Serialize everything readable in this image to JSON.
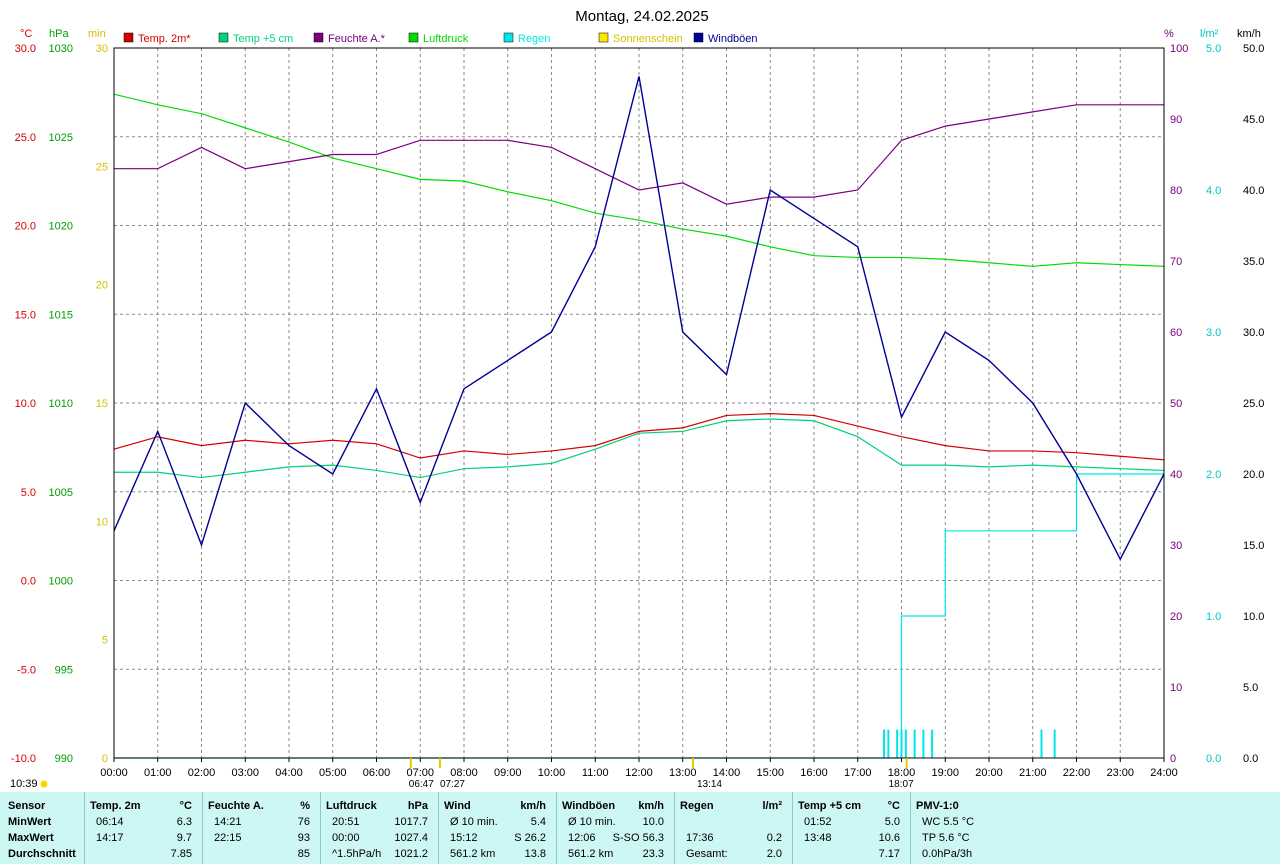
{
  "title": "Montag, 24.02.2025",
  "units": {
    "temp": "°C",
    "pressure": "hPa",
    "sunshine": "min",
    "humidity": "%",
    "rain": "l/m²",
    "wind": "km/h"
  },
  "legend": [
    {
      "label": "Temp. 2m*",
      "color": "#d40000"
    },
    {
      "label": "Temp +5 cm",
      "color": "#00d27a"
    },
    {
      "label": "Feuchte A.*",
      "color": "#7a0080"
    },
    {
      "label": "Luftdruck",
      "color": "#00dc00"
    },
    {
      "label": "Regen",
      "color": "#00e6e6"
    },
    {
      "label": "Sonnenschein",
      "color": "#ffe600"
    },
    {
      "label": "Windböen",
      "color": "#000096"
    }
  ],
  "axis_labels": {
    "temp": [
      "30.0",
      "25.0",
      "20.0",
      "15.0",
      "10.0",
      "5.0",
      "0.0",
      "-5.0",
      "-10.0"
    ],
    "pressure": [
      "1030",
      "1025",
      "1020",
      "1015",
      "1010",
      "1005",
      "1000",
      "995",
      "990"
    ],
    "sunshine": [
      "30",
      "25",
      "20",
      "15",
      "10",
      "5",
      "0"
    ],
    "humidity": [
      "100",
      "90",
      "80",
      "70",
      "60",
      "50",
      "40",
      "30",
      "20",
      "10",
      "0"
    ],
    "rain": [
      "5.0",
      "4.0",
      "3.0",
      "2.0",
      "1.0",
      "0.0"
    ],
    "wind": [
      "50.0",
      "45.0",
      "40.0",
      "35.0",
      "30.0",
      "25.0",
      "20.0",
      "15.0",
      "10.0",
      "5.0",
      "0.0"
    ],
    "time": [
      "00:00",
      "01:00",
      "02:00",
      "03:00",
      "04:00",
      "05:00",
      "06:00",
      "07:00",
      "08:00",
      "09:00",
      "10:00",
      "11:00",
      "12:00",
      "13:00",
      "14:00",
      "15:00",
      "16:00",
      "17:00",
      "18:00",
      "19:00",
      "20:00",
      "21:00",
      "22:00",
      "23:00",
      "24:00"
    ]
  },
  "markers": {
    "current_time": "10:39",
    "dawn": "06:47",
    "sunrise": "07:27",
    "solar_noon": "13:14",
    "sunset": "18:07"
  },
  "chart_data": {
    "type": "line",
    "xlabel": "",
    "xlim": [
      "00:00",
      "24:00"
    ],
    "axes": {
      "temp": [
        -10,
        30
      ],
      "pressure": [
        990,
        1030
      ],
      "sunshine": [
        0,
        30
      ],
      "humidity": [
        0,
        100
      ],
      "rain": [
        0,
        5
      ],
      "wind": [
        0,
        50
      ]
    },
    "x": [
      0,
      1,
      2,
      3,
      4,
      5,
      6,
      7,
      8,
      9,
      10,
      11,
      12,
      13,
      14,
      15,
      16,
      17,
      18,
      19,
      20,
      21,
      22,
      23,
      24
    ],
    "series": [
      {
        "name": "Temp. 2m*",
        "axis": "temp",
        "color": "#d40000",
        "values": [
          7.4,
          8.1,
          7.6,
          7.9,
          7.7,
          7.9,
          7.7,
          6.9,
          7.3,
          7.1,
          7.3,
          7.6,
          8.4,
          8.6,
          9.3,
          9.4,
          9.3,
          8.7,
          8.1,
          7.6,
          7.3,
          7.3,
          7.2,
          7.0,
          6.8
        ]
      },
      {
        "name": "Temp +5 cm",
        "axis": "temp",
        "color": "#00d27a",
        "values": [
          6.1,
          6.1,
          5.8,
          6.1,
          6.4,
          6.5,
          6.2,
          5.8,
          6.3,
          6.4,
          6.6,
          7.4,
          8.3,
          8.4,
          9.0,
          9.1,
          9.0,
          8.1,
          6.5,
          6.5,
          6.4,
          6.5,
          6.4,
          6.3,
          6.2
        ]
      },
      {
        "name": "Feuchte A.*",
        "axis": "humidity",
        "color": "#7a0080",
        "values": [
          83,
          83,
          86,
          83,
          84,
          85,
          85,
          87,
          87,
          87,
          86,
          83,
          80,
          81,
          78,
          79,
          79,
          80,
          87,
          89,
          90,
          91,
          92,
          92,
          92
        ]
      },
      {
        "name": "Luftdruck",
        "axis": "pressure",
        "color": "#00dc00",
        "values": [
          1027.4,
          1026.8,
          1026.3,
          1025.5,
          1024.7,
          1023.8,
          1023.2,
          1022.6,
          1022.5,
          1021.9,
          1021.4,
          1020.7,
          1020.3,
          1019.8,
          1019.4,
          1018.8,
          1018.3,
          1018.2,
          1018.2,
          1018.1,
          1017.9,
          1017.7,
          1017.9,
          1017.8,
          1017.7
        ]
      },
      {
        "name": "Regen",
        "axis": "rain",
        "color": "#00e6e6",
        "step": true,
        "values": [
          0,
          0,
          0,
          0,
          0,
          0,
          0,
          0,
          0,
          0,
          0,
          0,
          0,
          0,
          0,
          0,
          0,
          0,
          1.0,
          1.6,
          1.6,
          1.6,
          2.0,
          2.0,
          2.0
        ]
      },
      {
        "name": "Windböen",
        "axis": "wind",
        "color": "#000096",
        "values": [
          16,
          23,
          15,
          25,
          22,
          20,
          26,
          18,
          26,
          28,
          30,
          36,
          48,
          30,
          27,
          40,
          38,
          36,
          24,
          30,
          28,
          25,
          20,
          14,
          20
        ]
      }
    ],
    "bars": {
      "name": "Regen",
      "axis": "rain",
      "color": "#00e6e6",
      "x": [
        17.6,
        17.7,
        17.9,
        18.0,
        18.1,
        18.3,
        18.5,
        18.7,
        21.2,
        21.5
      ],
      "values": [
        0.2,
        0.2,
        0.2,
        0.2,
        0.2,
        0.2,
        0.2,
        0.2,
        0.2,
        0.2
      ]
    }
  },
  "stats": {
    "row_labels": [
      "Sensor",
      "MinWert",
      "MaxWert",
      "Durchschnitt"
    ],
    "sections": [
      {
        "name": "Temp. 2m",
        "unit": "°C",
        "rows": [
          [
            "06:14",
            "6.3"
          ],
          [
            "14:17",
            "9.7"
          ],
          [
            "",
            "7.85"
          ]
        ]
      },
      {
        "name": "Feuchte A.",
        "unit": "%",
        "rows": [
          [
            "14:21",
            "76"
          ],
          [
            "22:15",
            "93"
          ],
          [
            "",
            "85"
          ]
        ]
      },
      {
        "name": "Luftdruck",
        "unit": "hPa",
        "rows": [
          [
            "20:51",
            "1017.7"
          ],
          [
            "00:00",
            "1027.4"
          ],
          [
            "^1.5hPa/h",
            "1021.2"
          ]
        ]
      },
      {
        "name": "Wind",
        "unit": "km/h",
        "rows": [
          [
            "Ø 10 min.",
            "5.4"
          ],
          [
            "15:12",
            "S 26.2"
          ],
          [
            "561.2 km",
            "13.8"
          ]
        ]
      },
      {
        "name": "Windböen",
        "unit": "km/h",
        "rows": [
          [
            "Ø 10 min.",
            "10.0"
          ],
          [
            "12:06",
            "S-SO 56.3"
          ],
          [
            "561.2 km",
            "23.3"
          ]
        ]
      },
      {
        "name": "Regen",
        "unit": "l/m²",
        "rows": [
          [
            "",
            ""
          ],
          [
            "17:36",
            "0.2"
          ],
          [
            "Gesamt:",
            "2.0"
          ]
        ]
      },
      {
        "name": "Temp +5 cm",
        "unit": "°C",
        "rows": [
          [
            "01:52",
            "5.0"
          ],
          [
            "13:48",
            "10.6"
          ],
          [
            "",
            "7.17"
          ]
        ]
      },
      {
        "name": "PMV-1:0",
        "unit": "",
        "rows": [
          [
            "WC 5.5 °C",
            ""
          ],
          [
            "TP 5.6 °C",
            ""
          ],
          [
            "0.0hPa/3h",
            ""
          ]
        ]
      }
    ]
  }
}
